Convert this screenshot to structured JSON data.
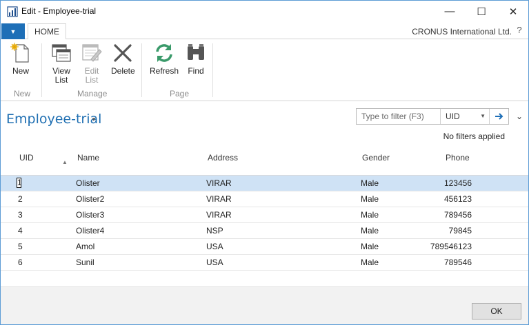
{
  "window": {
    "title": "Edit - Employee-trial",
    "minimize_glyph": "—",
    "maximize_glyph": "☐",
    "close_glyph": "✕"
  },
  "ribbon": {
    "app_menu_glyph": "▼",
    "tab_home": "HOME",
    "company": "CRONUS International Ltd.",
    "help_glyph": "?",
    "buttons": {
      "new": "New",
      "view_list_1": "View",
      "view_list_2": "List",
      "edit_list_1": "Edit",
      "edit_list_2": "List",
      "delete": "Delete",
      "refresh": "Refresh",
      "find": "Find"
    },
    "groups": {
      "new": "New",
      "manage": "Manage",
      "page": "Page"
    }
  },
  "page": {
    "title": "Employee-trial",
    "title_caret": "▼",
    "filter_placeholder": "Type to filter (F3)",
    "filter_field": "UID",
    "filter_caret": "▼",
    "collapse_caret": "⌄",
    "no_filters": "No filters applied"
  },
  "table": {
    "columns": {
      "uid": "UID",
      "name": "Name",
      "address": "Address",
      "gender": "Gender",
      "phone": "Phone"
    },
    "sort_glyph": "▲",
    "rows": [
      {
        "uid": "1",
        "name": "Olister",
        "address": "VIRAR",
        "gender": "Male",
        "phone": "123456"
      },
      {
        "uid": "2",
        "name": "Olister2",
        "address": "VIRAR",
        "gender": "Male",
        "phone": "456123"
      },
      {
        "uid": "3",
        "name": "Olister3",
        "address": "VIRAR",
        "gender": "Male",
        "phone": "789456"
      },
      {
        "uid": "4",
        "name": "Olister4",
        "address": "NSP",
        "gender": "Male",
        "phone": "79845"
      },
      {
        "uid": "5",
        "name": "Amol",
        "address": "USA",
        "gender": "Male",
        "phone": "789546123"
      },
      {
        "uid": "6",
        "name": "Sunil",
        "address": "USA",
        "gender": "Male",
        "phone": "789546"
      }
    ]
  },
  "footer": {
    "ok_label": "OK"
  },
  "colors": {
    "accent": "#1e6fb7",
    "selected_row": "#cfe2f5",
    "title_blue": "#1f6fb2"
  }
}
